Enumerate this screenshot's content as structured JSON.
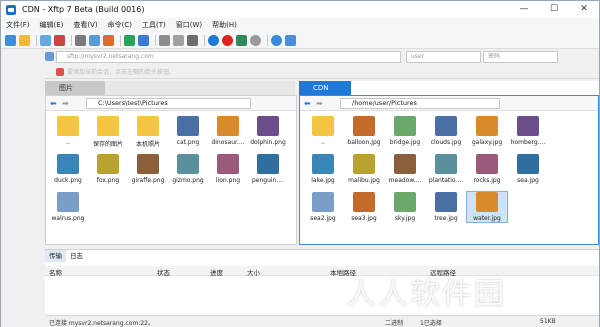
{
  "window": {
    "title": "CDN - Xftp 7 Beta (Build 0016)"
  },
  "menu": [
    "文件(F)",
    "编辑(E)",
    "查看(V)",
    "命令(C)",
    "工具(T)",
    "窗口(W)",
    "帮助(H)"
  ],
  "address": {
    "host_placeholder": "sftp://mysvr2.netsarang.com",
    "user_placeholder": "user",
    "password_placeholder": "密码"
  },
  "hint": "要添加当前会话，点击左侧的箭头按钮。",
  "left_tab": {
    "label": "图片"
  },
  "right_tab": {
    "label": "CDN"
  },
  "left_path": "C:\\Users\\test\\Pictures",
  "right_path": "/home/user/Pictures",
  "left_files": [
    {
      "name": "..",
      "type": "folder"
    },
    {
      "name": "保存的图片",
      "type": "folder"
    },
    {
      "name": "本机照片",
      "type": "folder"
    },
    {
      "name": "cat.png",
      "type": "image"
    },
    {
      "name": "dinosaur....",
      "type": "image"
    },
    {
      "name": "dolphin.png",
      "type": "image"
    },
    {
      "name": "duck.png",
      "type": "image"
    },
    {
      "name": "fox.png",
      "type": "image"
    },
    {
      "name": "giraffe.png",
      "type": "image"
    },
    {
      "name": "gizmo.png",
      "type": "image"
    },
    {
      "name": "lion.png",
      "type": "image"
    },
    {
      "name": "penguin....",
      "type": "image"
    },
    {
      "name": "walrus.png",
      "type": "image"
    }
  ],
  "right_files": [
    {
      "name": "..",
      "type": "folder"
    },
    {
      "name": "balloon.jpg",
      "type": "image"
    },
    {
      "name": "bridge.jpg",
      "type": "image"
    },
    {
      "name": "clouds.jpg",
      "type": "image"
    },
    {
      "name": "galaxy.jpg",
      "type": "image"
    },
    {
      "name": "homberg....",
      "type": "image"
    },
    {
      "name": "lake.jpg",
      "type": "image"
    },
    {
      "name": "malibu.jpg",
      "type": "image"
    },
    {
      "name": "meadow....",
      "type": "image"
    },
    {
      "name": "plantatio....",
      "type": "image"
    },
    {
      "name": "rocks.jpg",
      "type": "image"
    },
    {
      "name": "sea.jpg",
      "type": "image"
    },
    {
      "name": "sea2.jpg",
      "type": "image"
    },
    {
      "name": "sea3.jpg",
      "type": "image"
    },
    {
      "name": "sky.jpg",
      "type": "image"
    },
    {
      "name": "tree.jpg",
      "type": "image"
    },
    {
      "name": "water.jpg",
      "type": "image"
    }
  ],
  "log": {
    "tabs": [
      "传输",
      "日志"
    ],
    "columns": [
      "名称",
      "状态",
      "进度",
      "大小",
      "本地路径",
      "远程路径"
    ]
  },
  "status": {
    "host": "已连接 mysvr2.netsarang.com:22。",
    "mode": "二进制",
    "selected": "1已选择",
    "size": "51KB"
  },
  "colors": {
    "accent": "#1e7ad6",
    "folder": "#f4c542",
    "active_border": "#3b8ad8"
  }
}
